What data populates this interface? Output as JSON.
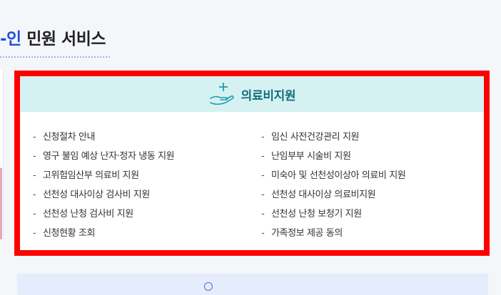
{
  "page": {
    "title_accent": "-인",
    "title_rest": " 민원 서비스"
  },
  "card": {
    "title": "의료비지원",
    "icon": "hand-plus-icon",
    "accent_color": "#126f7c",
    "header_bg": "#d5f1f2",
    "highlight_color": "#ff0000",
    "left_items": [
      "신청절차 안내",
      "영구 불임 예상 난자·정자 냉동 지원",
      "고위험임산부 의료비 지원",
      "선천성 대사이상 검사비 지원",
      "선천성 난청 검사비 지원",
      "신청현황 조회"
    ],
    "right_items": [
      "임신 사전건강관리 지원",
      "난임부부 시술비 지원",
      "미숙아 및 선천성이상아 의료비 지원",
      "선천성 대사이상 의료비지원",
      "선천성 난청 보청기 지원",
      "가족정보 제공 동의"
    ],
    "bullet": "-"
  }
}
